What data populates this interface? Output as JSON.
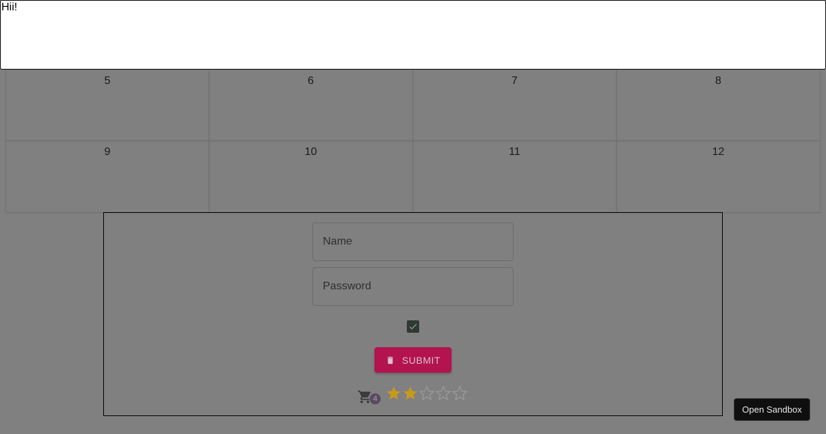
{
  "textarea": {
    "value": "Hii!"
  },
  "grid": {
    "cells": [
      "5",
      "6",
      "7",
      "8",
      "9",
      "10",
      "11",
      "12"
    ]
  },
  "form": {
    "name_label": "Name",
    "password_label": "Password",
    "checkbox_checked": true,
    "submit_label": "SUBMIT",
    "submit_icon": "trash-icon",
    "cart_icon": "shopping-cart-icon",
    "cart_count": "4",
    "rating": {
      "value": 2,
      "max": 5
    }
  },
  "colors": {
    "overlay": "#808080",
    "submit_bg": "#b3134f",
    "star_filled": "#c99a1a",
    "star_empty": "#9a9a9a"
  },
  "sandbox": {
    "label": "Open Sandbox"
  }
}
